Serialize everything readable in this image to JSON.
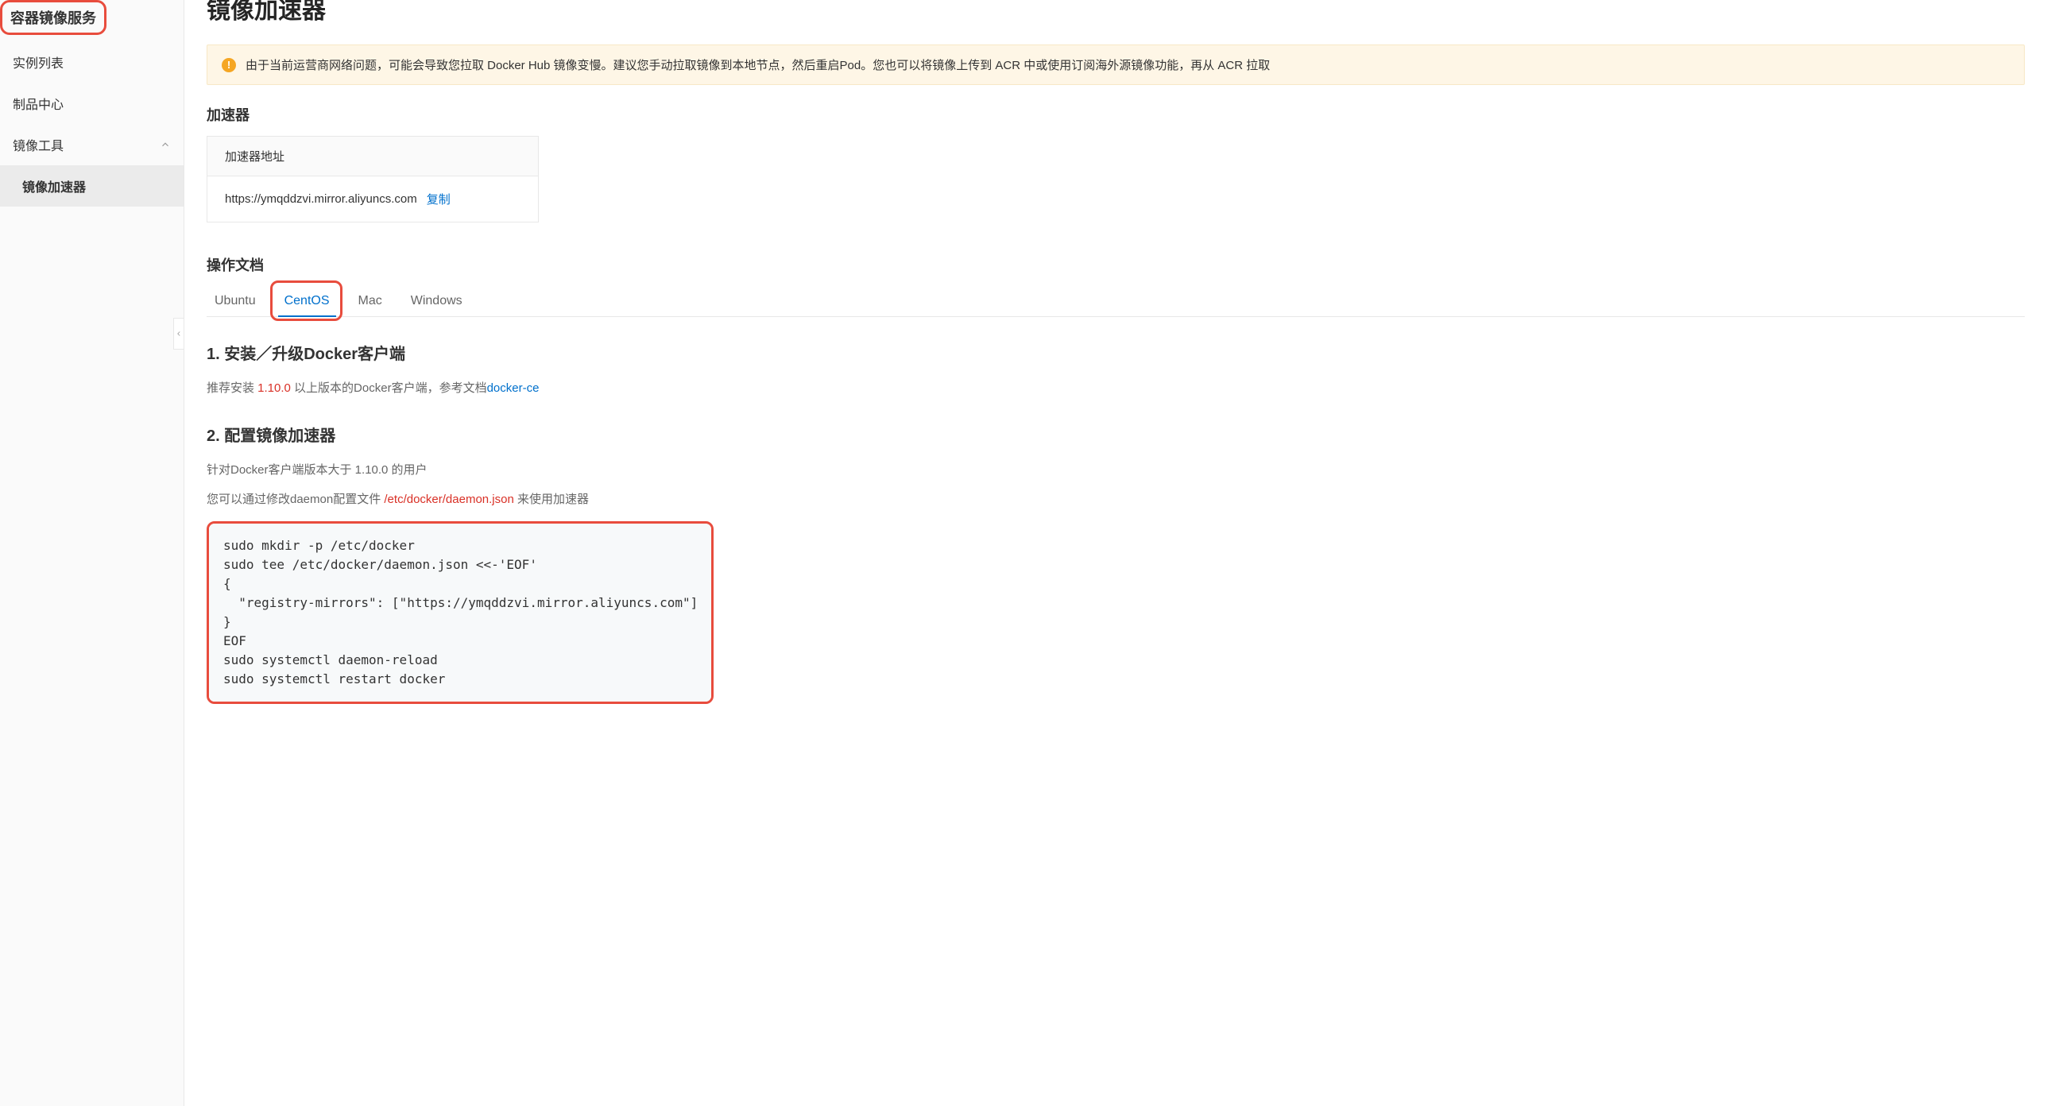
{
  "sidebar": {
    "title": "容器镜像服务",
    "items": [
      {
        "label": "实例列表",
        "has_chevron": false,
        "active": false
      },
      {
        "label": "制品中心",
        "has_chevron": false,
        "active": false
      },
      {
        "label": "镜像工具",
        "has_chevron": true,
        "active": false
      },
      {
        "label": "镜像加速器",
        "has_chevron": false,
        "active": true
      }
    ]
  },
  "main": {
    "title": "镜像加速器",
    "alert": "由于当前运营商网络问题，可能会导致您拉取 Docker Hub 镜像变慢。建议您手动拉取镜像到本地节点，然后重启Pod。您也可以将镜像上传到 ACR 中或使用订阅海外源镜像功能，再从 ACR 拉取",
    "accelerator": {
      "heading": "加速器",
      "box_header": "加速器地址",
      "url": "https://ymqddzvi.mirror.aliyuncs.com",
      "copy_label": "复制"
    },
    "docs": {
      "heading": "操作文档",
      "tabs": [
        "Ubuntu",
        "CentOS",
        "Mac",
        "Windows"
      ],
      "active_tab": 1,
      "step1": {
        "heading": "1. 安装／升级Docker客户端",
        "text_prefix": "推荐安装 ",
        "version": "1.10.0",
        "text_suffix": " 以上版本的Docker客户端，参考文档",
        "link": "docker-ce"
      },
      "step2": {
        "heading": "2. 配置镜像加速器",
        "text1": "针对Docker客户端版本大于 1.10.0 的用户",
        "text2_prefix": "您可以通过修改daemon配置文件 ",
        "config_path": "/etc/docker/daemon.json",
        "text2_suffix": " 来使用加速器",
        "code": "sudo mkdir -p /etc/docker\nsudo tee /etc/docker/daemon.json <<-'EOF'\n{\n  \"registry-mirrors\": [\"https://ymqddzvi.mirror.aliyuncs.com\"]\n}\nEOF\nsudo systemctl daemon-reload\nsudo systemctl restart docker"
      }
    }
  }
}
